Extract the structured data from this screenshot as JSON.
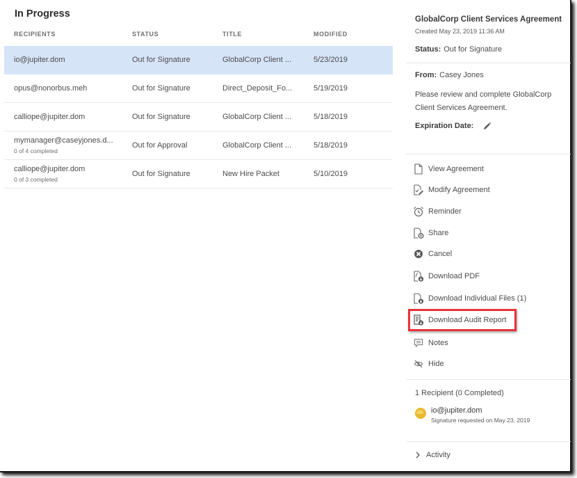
{
  "list": {
    "title": "In Progress",
    "columns": [
      "RECIPIENTS",
      "STATUS",
      "TITLE",
      "MODIFIED"
    ],
    "rows": [
      {
        "recipient": "io@jupiter.dom",
        "sub": "",
        "status": "Out for Signature",
        "title": "GlobalCorp Client ...",
        "modified": "5/23/2019",
        "selected": true
      },
      {
        "recipient": "opus@nonorbus.meh",
        "sub": "",
        "status": "Out for Signature",
        "title": "Direct_Deposit_Fo...",
        "modified": "5/19/2019",
        "selected": false
      },
      {
        "recipient": "calliope@jupiter.dom",
        "sub": "",
        "status": "Out for Signature",
        "title": "GlobalCorp Client ...",
        "modified": "5/18/2019",
        "selected": false
      },
      {
        "recipient": "mymanager@caseyjones.d...",
        "sub": "0 of 4 completed",
        "status": "Out for Approval",
        "title": "GlobalCorp Client ...",
        "modified": "5/18/2019",
        "selected": false
      },
      {
        "recipient": "calliope@jupiter.dom",
        "sub": "0 of 3 completed",
        "status": "Out for Signature",
        "title": "New Hire Packet",
        "modified": "5/10/2019",
        "selected": false
      }
    ]
  },
  "panel": {
    "title": "GlobalCorp Client Services Agreement",
    "created": "Created May 23, 2019 11:36 AM",
    "status_label": "Status:",
    "status_value": "Out for Signature",
    "from_label": "From:",
    "from_value": "Casey Jones",
    "message": "Please review and complete GlobalCorp Client Services Agreement.",
    "expiration_label": "Expiration Date:",
    "actions": [
      {
        "label": "View Agreement",
        "icon": "document-icon"
      },
      {
        "label": "Modify Agreement",
        "icon": "document-edit-icon"
      },
      {
        "label": "Reminder",
        "icon": "alarm-clock-icon"
      },
      {
        "label": "Share",
        "icon": "document-share-icon"
      },
      {
        "label": "Cancel",
        "icon": "cancel-circle-icon"
      },
      {
        "label": "Download PDF",
        "icon": "pdf-download-icon"
      },
      {
        "label": "Download Individual Files (1)",
        "icon": "file-download-icon"
      },
      {
        "label": "Download Audit Report",
        "icon": "audit-report-download-icon"
      },
      {
        "label": "Notes",
        "icon": "notes-icon"
      },
      {
        "label": "Hide",
        "icon": "hide-eye-icon"
      }
    ],
    "recipients_heading": "1 Recipient (0 Completed)",
    "recipient": {
      "email": "io@jupiter.dom",
      "detail": "Signature requested on May 23, 2019"
    },
    "activity_label": "Activity"
  },
  "colors": {
    "selected_row": "#d6e4f8",
    "highlight_border": "#e8323a",
    "avatar": "#e9b92e"
  }
}
